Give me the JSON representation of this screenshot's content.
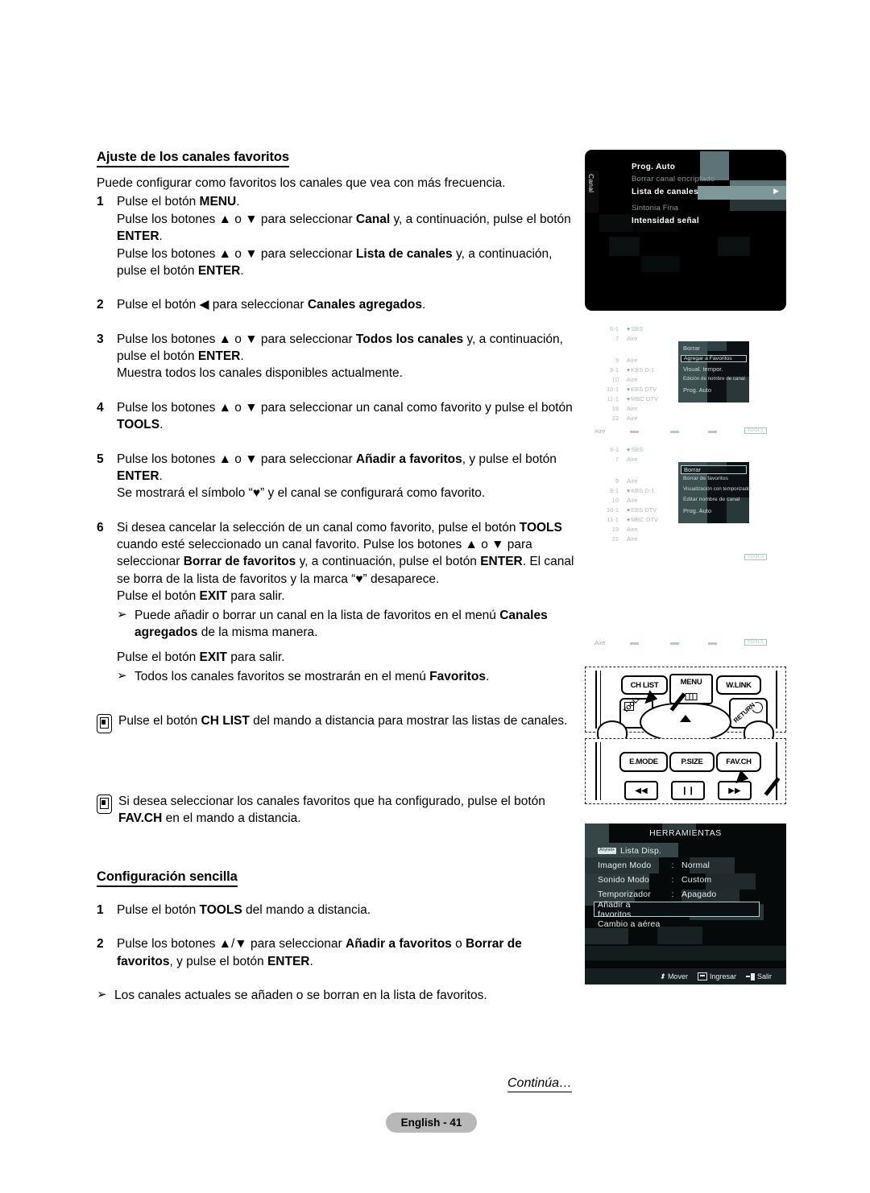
{
  "section": {
    "heading": "Ajuste de los canales favoritos",
    "lead": "Puede configurar como favoritos los canales que vea con más frecuencia."
  },
  "steps": [
    {
      "num": "1",
      "lines": [
        [
          {
            "t": "Pulse el botón "
          },
          {
            "t": "MENU",
            "b": true
          },
          {
            "t": "."
          }
        ],
        [
          {
            "t": "Pulse los botones ▲ o ▼ para seleccionar "
          },
          {
            "t": "Canal",
            "b": true
          },
          {
            "t": " y, a continuación, pulse el botón "
          },
          {
            "t": "ENTER",
            "b": true
          },
          {
            "t": "."
          }
        ],
        [
          {
            "t": "Pulse los botones ▲ o ▼ para seleccionar "
          },
          {
            "t": "Lista de canales",
            "b": true
          },
          {
            "t": " y, a continuación, pulse el botón "
          },
          {
            "t": "ENTER",
            "b": true
          },
          {
            "t": "."
          }
        ]
      ]
    },
    {
      "num": "2",
      "lines": [
        [
          {
            "t": "Pulse el botón ◀ para seleccionar "
          },
          {
            "t": "Canales agregados",
            "b": true
          },
          {
            "t": "."
          }
        ]
      ]
    },
    {
      "num": "3",
      "lines": [
        [
          {
            "t": "Pulse los botones ▲ o ▼ para seleccionar "
          },
          {
            "t": "Todos los canales",
            "b": true
          },
          {
            "t": " y, a continuación, pulse el botón "
          },
          {
            "t": "ENTER",
            "b": true
          },
          {
            "t": "."
          }
        ],
        [
          {
            "t": "Muestra todos los canales disponibles actualmente."
          }
        ]
      ]
    },
    {
      "num": "4",
      "lines": [
        [
          {
            "t": "Pulse los botones ▲ o ▼ para seleccionar un canal como favorito y pulse el botón "
          },
          {
            "t": "TOOLS",
            "b": true
          },
          {
            "t": "."
          }
        ]
      ]
    },
    {
      "num": "5",
      "lines": [
        [
          {
            "t": "Pulse los botones ▲ o ▼ para seleccionar "
          },
          {
            "t": "Añadir a favoritos",
            "b": true
          },
          {
            "t": ", y pulse el botón "
          },
          {
            "t": "ENTER",
            "b": true
          },
          {
            "t": "."
          }
        ],
        [
          {
            "t": "Se mostrará el símbolo “♥” y el canal se configurará como favorito."
          }
        ]
      ]
    },
    {
      "num": "6",
      "lines": [
        [
          {
            "t": "Si desea cancelar la selección de un canal como favorito, pulse el botón "
          },
          {
            "t": "TOOLS",
            "b": true
          },
          {
            "t": " cuando esté seleccionado un canal favorito. Pulse los botones ▲ o ▼ para seleccionar "
          },
          {
            "t": "Borrar de favoritos",
            "b": true
          },
          {
            "t": " y, a continuación, pulse el botón "
          },
          {
            "t": "ENTER",
            "b": true
          },
          {
            "t": ". El canal se borra de la lista de favoritos y la marca “♥” desaparece."
          }
        ],
        [
          {
            "t": "Pulse el botón "
          },
          {
            "t": "EXIT",
            "b": true
          },
          {
            "t": " para salir."
          }
        ]
      ]
    }
  ],
  "bullets": [
    {
      "lines": [
        [
          {
            "t": "Puede añadir o borrar un canal en la lista de favoritos en el menú "
          },
          {
            "t": "Canales agregados",
            "b": true
          },
          {
            "t": " de la misma manera."
          }
        ]
      ]
    }
  ],
  "exit_line": [
    {
      "t": "Pulse el botón "
    },
    {
      "t": "EXIT",
      "b": true
    },
    {
      "t": " para salir."
    }
  ],
  "bullet_fav": [
    {
      "t": "Todos los canales favoritos se mostrarán en el menú "
    },
    {
      "t": "Favoritos",
      "b": true
    },
    {
      "t": "."
    }
  ],
  "notes": [
    {
      "lines": [
        [
          {
            "t": "Pulse el botón "
          },
          {
            "t": "CH LIST",
            "b": true
          },
          {
            "t": " del mando a distancia para mostrar las listas de canales."
          }
        ]
      ]
    },
    {
      "lines": [
        [
          {
            "t": "Si desea seleccionar los canales favoritos que ha configurado, pulse el botón "
          },
          {
            "t": "FAV.CH",
            "b": true
          },
          {
            "t": " en el mando a distancia."
          }
        ]
      ]
    }
  ],
  "section2": {
    "heading": "Configuración sencilla",
    "steps": [
      {
        "num": "1",
        "lines": [
          [
            {
              "t": "Pulse el botón "
            },
            {
              "t": "TOOLS",
              "b": true
            },
            {
              "t": " del mando a distancia."
            }
          ]
        ]
      },
      {
        "num": "2",
        "lines": [
          [
            {
              "t": "Pulse los botones ▲/▼ para seleccionar "
            },
            {
              "t": "Añadir a favoritos",
              "b": true
            },
            {
              "t": " o "
            },
            {
              "t": "Borrar de favoritos",
              "b": true
            },
            {
              "t": ", y pulse el botón "
            },
            {
              "t": "ENTER",
              "b": true
            },
            {
              "t": "."
            }
          ]
        ]
      }
    ],
    "bullet": [
      {
        "t": "Los canales actuales se añaden o se borran en la lista de favoritos."
      }
    ]
  },
  "tv_menu": {
    "tab_label": "Canal",
    "items": [
      {
        "label": "Prog. Auto",
        "style": "bold"
      },
      {
        "label": "Borrar canal encriptado",
        "style": "dim"
      },
      {
        "label": "Lista de canales",
        "style": "selected"
      },
      {
        "label": "Sintonia Fina",
        "style": "dim"
      },
      {
        "label": "Intensidad señal",
        "style": "bold"
      }
    ],
    "arrow_glyph": "▶"
  },
  "channel_lists": [
    {
      "channels": [
        {
          "num": "6-1",
          "fav": true,
          "name": "SBS"
        },
        {
          "num": "7",
          "fav": false,
          "name": "Aire"
        },
        {
          "num": "9",
          "fav": false,
          "name": "Aire"
        },
        {
          "num": "9-1",
          "fav": true,
          "name": "KBS D-1"
        },
        {
          "num": "10",
          "fav": false,
          "name": "Aire"
        },
        {
          "num": "10-1",
          "fav": true,
          "name": "EBS DTV"
        },
        {
          "num": "11-1",
          "fav": true,
          "name": "MBC DTV"
        },
        {
          "num": "19",
          "fav": false,
          "name": "Aire"
        },
        {
          "num": "22",
          "fav": false,
          "name": "Aire"
        }
      ],
      "popup": [
        {
          "label": "Borrar",
          "selected": false
        },
        {
          "label": "Agregar a Favoritos",
          "selected": true
        },
        {
          "label": "Visual. tempor.",
          "selected": false
        },
        {
          "label": "Edición de nombre de canal",
          "selected": false
        },
        {
          "label": "Prog. Auto",
          "selected": false
        }
      ],
      "bar_label": "Aire",
      "bar_tools": "TOOLS",
      "show_bar": true
    },
    {
      "channels": [
        {
          "num": "6-1",
          "fav": true,
          "name": "SBS"
        },
        {
          "num": "7",
          "fav": false,
          "name": "Aire"
        },
        {
          "num": "9",
          "fav": false,
          "name": "Aire"
        },
        {
          "num": "9-1",
          "fav": true,
          "name": "KBS D-1"
        },
        {
          "num": "10",
          "fav": false,
          "name": "Aire"
        },
        {
          "num": "10-1",
          "fav": true,
          "name": "EBS DTV"
        },
        {
          "num": "11-1",
          "fav": true,
          "name": "MBC DTV"
        },
        {
          "num": "19",
          "fav": false,
          "name": "Aire"
        },
        {
          "num": "22",
          "fav": false,
          "name": "Aire"
        }
      ],
      "popup": [
        {
          "label": "Borrar",
          "selected": true
        },
        {
          "label": "Borrar de favoritos",
          "selected": false
        },
        {
          "label": "Visualización con temporizador",
          "selected": false
        },
        {
          "label": "Editar nombre de canal",
          "selected": false
        },
        {
          "label": "Prog. Auto",
          "selected": false
        }
      ],
      "bar_label": "Aire",
      "bar_tools": "TOOLS",
      "show_bar": false
    }
  ],
  "bottom_bar": {
    "label": "Aire",
    "tools": "TOOLS"
  },
  "remote_top": {
    "buttons": [
      "CH LIST",
      "MENU",
      "W.LINK"
    ],
    "tools_label": "TOOLS",
    "return_label": "RETURN"
  },
  "remote_bottom": {
    "buttons": [
      "E.MODE",
      "P.SIZE",
      "FAV.CH"
    ],
    "transport": [
      "◀◀",
      "❙❙",
      "▶▶"
    ]
  },
  "tools_osd": {
    "title": "HERRAMIENTAS",
    "items": [
      {
        "badge": "Anynet+",
        "name": "Lista Disp.",
        "colon": "",
        "value": "",
        "selected": false
      },
      {
        "badge": "",
        "name": "Imagen Modo",
        "colon": ":",
        "value": "Normal",
        "selected": false
      },
      {
        "badge": "",
        "name": "Sonido Modo",
        "colon": ":",
        "value": "Custom",
        "selected": false
      },
      {
        "badge": "",
        "name": "Temporizador",
        "colon": ":",
        "value": "Apagado",
        "selected": false
      },
      {
        "badge": "",
        "name": "Añadir a favoritos",
        "colon": "",
        "value": "",
        "selected": true
      },
      {
        "badge": "",
        "name": "Cambio a aérea",
        "colon": "",
        "value": "",
        "selected": false
      }
    ],
    "footer": [
      {
        "icon": "updown-icon",
        "label": "Mover"
      },
      {
        "icon": "enter-icon",
        "label": "Ingresar"
      },
      {
        "icon": "exit-icon",
        "label": "Salir"
      }
    ]
  },
  "footer": {
    "continues": "Continúa…",
    "page_badge": "English - 41"
  },
  "colors": {
    "osd_bg": "#000000",
    "osd_highlight": "#7e989a",
    "osd_block": "#5d7375",
    "faded_text": "#aebbbd",
    "badge_bg": "#b8b8b8"
  }
}
